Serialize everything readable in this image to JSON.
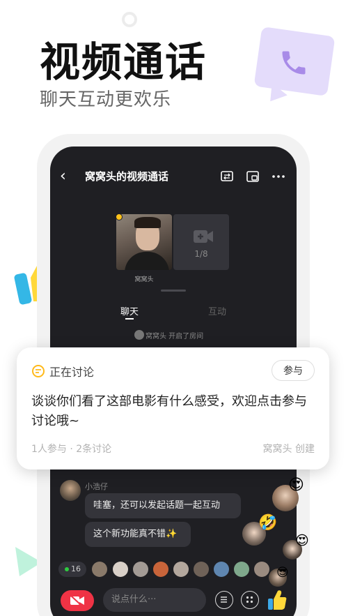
{
  "headline": "视频通话",
  "subline": "聊天互动更欢乐",
  "call": {
    "title": "窝窝头的视频通话",
    "participant_name": "窝窝头",
    "slot_count": "1/8",
    "tabs": [
      {
        "label": "聊天",
        "active": true
      },
      {
        "label": "互动",
        "active": false
      }
    ],
    "system_message": "窝窝头 开启了房间"
  },
  "topic_card": {
    "status": "正在讨论",
    "join_label": "参与",
    "text": "谈谈你们看了这部电影有什么感受，欢迎点击参与讨论哦~",
    "meta": "1人参与 · 2条讨论",
    "creator": "窝窝头 创建"
  },
  "chat": {
    "sender": "小浩仔",
    "messages": [
      "哇塞，还可以发起话题一起互动",
      "这个新功能真不错✨"
    ]
  },
  "footer": {
    "online_count": "16",
    "input_placeholder": "说点什么···"
  },
  "colors": {
    "accent_red": "#ef3345",
    "online_green": "#2ecc40",
    "status_yellow": "#ffc21a",
    "bubble_purple": "#e4dcfb"
  },
  "icons": [
    "back-icon",
    "switch-screen-icon",
    "window-icon",
    "more-icon",
    "video-add-icon",
    "topic-icon",
    "hangup-icon",
    "menu-icon",
    "grid-icon",
    "like-icon"
  ]
}
